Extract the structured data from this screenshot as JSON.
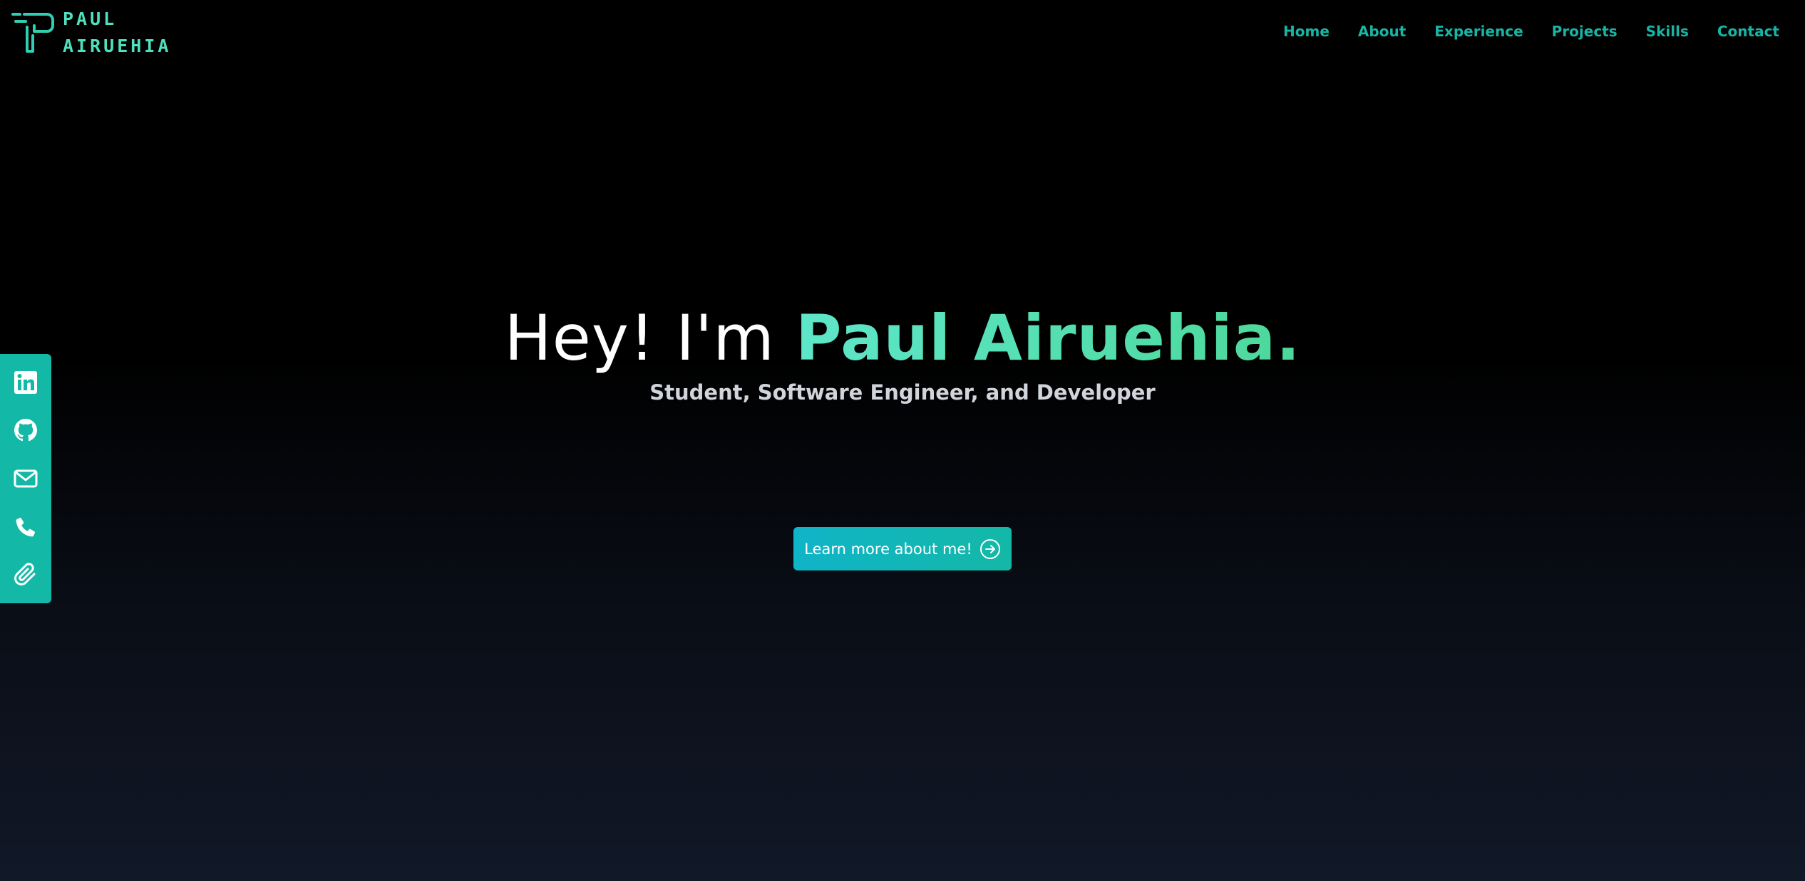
{
  "brand": {
    "line1": "PAUL",
    "line2": "AIRUEHIA",
    "accent_color": "#4fe0bd"
  },
  "nav": {
    "items": [
      {
        "label": "Home"
      },
      {
        "label": "About"
      },
      {
        "label": "Experience"
      },
      {
        "label": "Projects"
      },
      {
        "label": "Skills"
      },
      {
        "label": "Contact"
      }
    ],
    "color": "#19b5a4"
  },
  "hero": {
    "greeting": "Hey! I'm ",
    "name": "Paul Airuehia.",
    "subtitle": "Student, Software Engineer, and Developer",
    "cta_label": "Learn more about me!",
    "cta_icon": "arrow-right-circle-icon"
  },
  "social": {
    "background": "#14b8a6",
    "items": [
      {
        "icon": "linkedin-icon"
      },
      {
        "icon": "github-icon"
      },
      {
        "icon": "mail-icon"
      },
      {
        "icon": "phone-icon"
      },
      {
        "icon": "paperclip-icon"
      }
    ]
  }
}
